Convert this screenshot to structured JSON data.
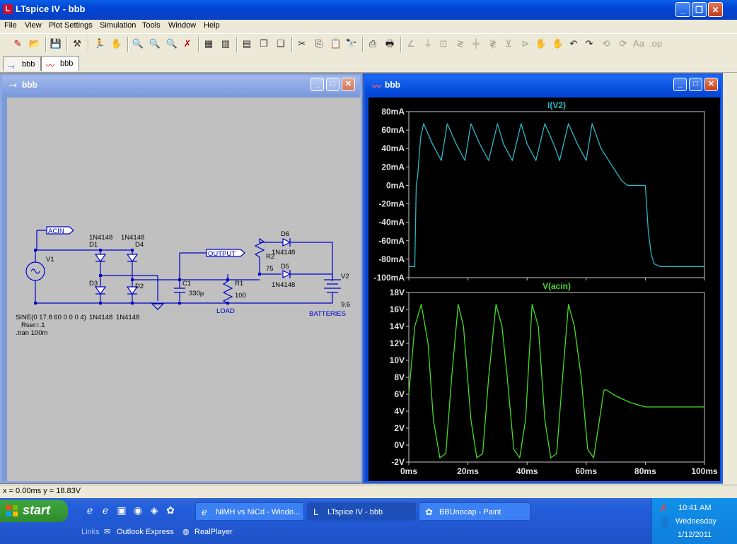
{
  "app": {
    "title": "LTspice IV - bbb",
    "menu": [
      "File",
      "View",
      "Plot Settings",
      "Simulation",
      "Tools",
      "Window",
      "Help"
    ],
    "tabs": [
      {
        "label": "bbb",
        "icon": "schematic-icon"
      },
      {
        "label": "bbb",
        "icon": "waveform-icon"
      }
    ]
  },
  "schematic_window": {
    "title": "bbb",
    "labels": {
      "acin": "ACIN",
      "output": "OUTPUT",
      "v1": "V1",
      "v1_params_1": "SINE(0 17.8 60 0 0 0 4)",
      "v1_params_2": "Rser=.1",
      "tran": ".tran 100m",
      "d1": "D1",
      "d1_model": "1N4148",
      "d4": "D4",
      "d4_model": "1N4148",
      "d3": "D3",
      "d3_model": "1N4148",
      "d2": "D2",
      "d2_model": "1N4148",
      "c1": "C1",
      "c1_value": "330µ",
      "r1": "R1",
      "r1_value": "100",
      "load": "LOAD",
      "r2": "R2",
      "r2_value": "75",
      "d6": "D6",
      "d6_model": "1N4148",
      "d5": "D5",
      "d5_model": "1N4148",
      "v2": "V2",
      "v2_value": "9.6",
      "batteries": "BATTERIES"
    }
  },
  "plot_window": {
    "title": "bbb"
  },
  "chart_data": [
    {
      "type": "line",
      "title": "I(V2)",
      "color": "#2ab8c8",
      "x_unit": "ms",
      "y_unit": "mA",
      "xlim": [
        0,
        100
      ],
      "ylim": [
        -100,
        80
      ],
      "y_ticks": [
        "80mA",
        "60mA",
        "40mA",
        "20mA",
        "0mA",
        "-20mA",
        "-40mA",
        "-60mA",
        "-80mA",
        "-100mA"
      ],
      "x": [
        0,
        1,
        2,
        2.5,
        3,
        4,
        5,
        8,
        11,
        13,
        16,
        19,
        21,
        24,
        27,
        30,
        32,
        35,
        38,
        40,
        43,
        46,
        49,
        51,
        54,
        57,
        60,
        62,
        65,
        72,
        74,
        76,
        78,
        80,
        81,
        82,
        83,
        85,
        90,
        100
      ],
      "y": [
        -88,
        -88,
        -88,
        0,
        10,
        52,
        67,
        45,
        27,
        67,
        45,
        27,
        67,
        45,
        27,
        67,
        45,
        27,
        67,
        45,
        27,
        67,
        45,
        27,
        67,
        45,
        27,
        67,
        40,
        5,
        0,
        0,
        0,
        0,
        -50,
        -75,
        -85,
        -88,
        -88,
        -88
      ]
    },
    {
      "type": "line",
      "title": "V(acin)",
      "color": "#44dd22",
      "x_unit": "ms",
      "y_unit": "V",
      "xlim": [
        0,
        100
      ],
      "ylim": [
        -2,
        18
      ],
      "y_ticks": [
        "18V",
        "16V",
        "14V",
        "12V",
        "10V",
        "8V",
        "6V",
        "4V",
        "2V",
        "0V",
        "-2V"
      ],
      "x_ticks": [
        "0ms",
        "20ms",
        "40ms",
        "60ms",
        "80ms",
        "100ms"
      ],
      "x": [
        0,
        2,
        4.2,
        6.5,
        8.3,
        10.5,
        12.5,
        14.5,
        16.7,
        18.5,
        21,
        23,
        25,
        27,
        29.5,
        31.5,
        33.3,
        35.5,
        37.5,
        39.5,
        41.7,
        43.8,
        46,
        48,
        50,
        52,
        54,
        56,
        58.3,
        60.5,
        62.5,
        64.5,
        66,
        66.8,
        70,
        75,
        80,
        85,
        100
      ],
      "y": [
        6,
        14,
        16.6,
        12,
        3,
        -1.5,
        -1,
        8,
        16.6,
        14,
        3,
        -1.5,
        -1,
        8,
        16.6,
        14,
        8,
        -0.5,
        -1.5,
        3,
        16.6,
        14,
        3,
        -1.5,
        -1,
        8,
        16.6,
        14,
        8,
        -0.5,
        -1.5,
        3,
        6.5,
        6.5,
        5.8,
        5,
        4.5,
        4.5,
        4.5
      ]
    }
  ],
  "status": {
    "coords": "x = 0.00ms    y = 18.83V"
  },
  "taskbar": {
    "start": "start",
    "links_label": "Links",
    "links": [
      "Outlook Express",
      "RealPlayer"
    ],
    "tasks": [
      {
        "label": "NiMH vs NiCd - Windo...",
        "icon": "ie-icon"
      },
      {
        "label": "LTspice IV - bbb",
        "icon": "ltspice-icon",
        "active": true
      },
      {
        "label": "BBUnocap - Paint",
        "icon": "paint-icon"
      }
    ],
    "clock": {
      "time": "10:41 AM",
      "day": "Wednesday",
      "date": "1/12/2011"
    }
  }
}
